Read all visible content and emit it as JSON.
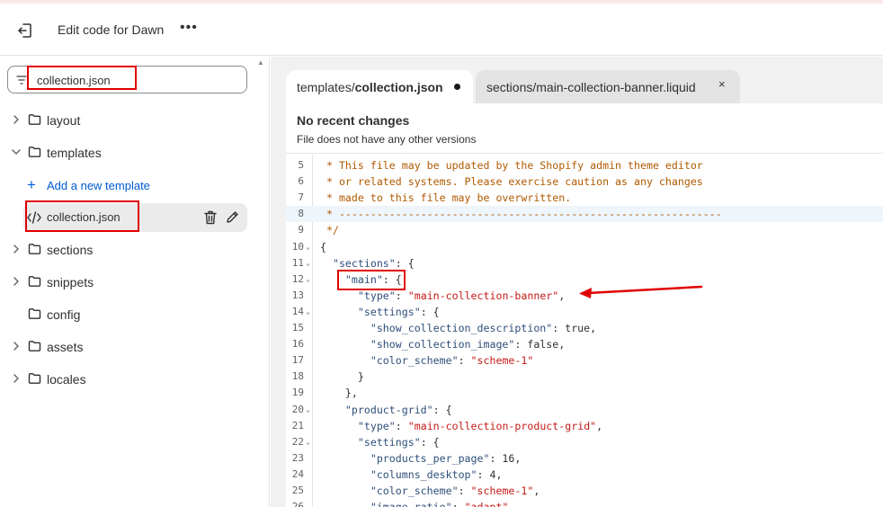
{
  "header": {
    "title": "Edit code for Dawn",
    "more_label": "•••"
  },
  "search": {
    "value": "collection.json"
  },
  "tree": {
    "folders": [
      {
        "name": "layout",
        "expanded": false
      },
      {
        "name": "templates",
        "expanded": true
      },
      {
        "name": "sections",
        "expanded": false
      },
      {
        "name": "snippets",
        "expanded": false
      },
      {
        "name": "config",
        "expanded": false
      },
      {
        "name": "assets",
        "expanded": false
      },
      {
        "name": "locales",
        "expanded": false
      }
    ],
    "add_template_label": "Add a new template",
    "selected_file": "collection.json"
  },
  "tabs": [
    {
      "prefix": "templates/",
      "file": "collection.json",
      "modified": true,
      "active": true
    },
    {
      "label": "sections/main-collection-banner.liquid",
      "close": "×",
      "active": false
    }
  ],
  "changes": {
    "title": "No recent changes",
    "subtitle": "File does not have any other versions"
  },
  "editor": {
    "highlighted_line": 8,
    "lines": [
      {
        "n": "5",
        "fold": false,
        "t": [
          {
            "c": "cm",
            "s": " * This file may be updated by the Shopify admin theme editor"
          }
        ]
      },
      {
        "n": "6",
        "fold": false,
        "t": [
          {
            "c": "cm",
            "s": " * or related systems. Please exercise caution as any changes"
          }
        ]
      },
      {
        "n": "7",
        "fold": false,
        "t": [
          {
            "c": "cm",
            "s": " * made to this file may be overwritten."
          }
        ]
      },
      {
        "n": "8",
        "fold": false,
        "t": [
          {
            "c": "cm",
            "s": " * -------------------------------------------------------------"
          }
        ]
      },
      {
        "n": "9",
        "fold": false,
        "t": [
          {
            "c": "cm",
            "s": " */"
          }
        ]
      },
      {
        "n": "10",
        "fold": true,
        "t": [
          {
            "c": "kw",
            "s": "{"
          }
        ]
      },
      {
        "n": "11",
        "fold": true,
        "t": [
          {
            "c": "kw",
            "s": "  "
          },
          {
            "c": "key",
            "s": "\"sections\""
          },
          {
            "c": "kw",
            "s": ": {"
          }
        ]
      },
      {
        "n": "12",
        "fold": true,
        "t": [
          {
            "c": "kw",
            "s": "    "
          },
          {
            "c": "key",
            "s": "\"main\""
          },
          {
            "c": "kw",
            "s": ": {"
          }
        ]
      },
      {
        "n": "13",
        "fold": false,
        "t": [
          {
            "c": "kw",
            "s": "      "
          },
          {
            "c": "key",
            "s": "\"type\""
          },
          {
            "c": "kw",
            "s": ": "
          },
          {
            "c": "str",
            "s": "\"main-collection-banner\""
          },
          {
            "c": "kw",
            "s": ","
          }
        ]
      },
      {
        "n": "14",
        "fold": true,
        "t": [
          {
            "c": "kw",
            "s": "      "
          },
          {
            "c": "key",
            "s": "\"settings\""
          },
          {
            "c": "kw",
            "s": ": {"
          }
        ]
      },
      {
        "n": "15",
        "fold": false,
        "t": [
          {
            "c": "kw",
            "s": "        "
          },
          {
            "c": "key",
            "s": "\"show_collection_description\""
          },
          {
            "c": "kw",
            "s": ": true,"
          }
        ]
      },
      {
        "n": "16",
        "fold": false,
        "t": [
          {
            "c": "kw",
            "s": "        "
          },
          {
            "c": "key",
            "s": "\"show_collection_image\""
          },
          {
            "c": "kw",
            "s": ": false,"
          }
        ]
      },
      {
        "n": "17",
        "fold": false,
        "t": [
          {
            "c": "kw",
            "s": "        "
          },
          {
            "c": "key",
            "s": "\"color_scheme\""
          },
          {
            "c": "kw",
            "s": ": "
          },
          {
            "c": "str",
            "s": "\"scheme-1\""
          }
        ]
      },
      {
        "n": "18",
        "fold": false,
        "t": [
          {
            "c": "kw",
            "s": "      }"
          }
        ]
      },
      {
        "n": "19",
        "fold": false,
        "t": [
          {
            "c": "kw",
            "s": "    },"
          }
        ]
      },
      {
        "n": "20",
        "fold": true,
        "t": [
          {
            "c": "kw",
            "s": "    "
          },
          {
            "c": "key",
            "s": "\"product-grid\""
          },
          {
            "c": "kw",
            "s": ": {"
          }
        ]
      },
      {
        "n": "21",
        "fold": false,
        "t": [
          {
            "c": "kw",
            "s": "      "
          },
          {
            "c": "key",
            "s": "\"type\""
          },
          {
            "c": "kw",
            "s": ": "
          },
          {
            "c": "str",
            "s": "\"main-collection-product-grid\""
          },
          {
            "c": "kw",
            "s": ","
          }
        ]
      },
      {
        "n": "22",
        "fold": true,
        "t": [
          {
            "c": "kw",
            "s": "      "
          },
          {
            "c": "key",
            "s": "\"settings\""
          },
          {
            "c": "kw",
            "s": ": {"
          }
        ]
      },
      {
        "n": "23",
        "fold": false,
        "t": [
          {
            "c": "kw",
            "s": "        "
          },
          {
            "c": "key",
            "s": "\"products_per_page\""
          },
          {
            "c": "kw",
            "s": ": 16,"
          }
        ]
      },
      {
        "n": "24",
        "fold": false,
        "t": [
          {
            "c": "kw",
            "s": "        "
          },
          {
            "c": "key",
            "s": "\"columns_desktop\""
          },
          {
            "c": "kw",
            "s": ": 4,"
          }
        ]
      },
      {
        "n": "25",
        "fold": false,
        "t": [
          {
            "c": "kw",
            "s": "        "
          },
          {
            "c": "key",
            "s": "\"color_scheme\""
          },
          {
            "c": "kw",
            "s": ": "
          },
          {
            "c": "str",
            "s": "\"scheme-1\""
          },
          {
            "c": "kw",
            "s": ","
          }
        ]
      },
      {
        "n": "26",
        "fold": false,
        "t": [
          {
            "c": "kw",
            "s": "        "
          },
          {
            "c": "key",
            "s": "\"image_ratio\""
          },
          {
            "c": "kw",
            "s": ": "
          },
          {
            "c": "str",
            "s": "\"adapt\""
          }
        ]
      }
    ]
  },
  "colors": {
    "annotation_red": "#e00000",
    "link_blue": "#005bd3",
    "selected_bg": "#ebebeb"
  }
}
